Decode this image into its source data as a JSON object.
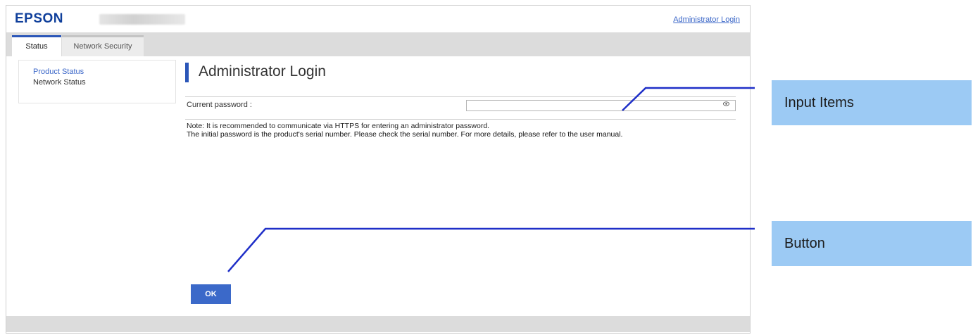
{
  "header": {
    "logo": "EPSON",
    "admin_login_link": "Administrator Login"
  },
  "tabs": [
    {
      "label": "Status",
      "active": true
    },
    {
      "label": "Network Security",
      "active": false
    }
  ],
  "sidebar": {
    "items": [
      {
        "label": "Product Status",
        "selected": true
      },
      {
        "label": "Network Status",
        "selected": false
      }
    ]
  },
  "main": {
    "title": "Administrator Login",
    "password_label": "Current password :",
    "password_value": "",
    "note_line1": "Note: It is recommended to communicate via HTTPS for entering an administrator password.",
    "note_line2": "The initial password is the product's serial number. Please check the serial number. For more details, please refer to the user manual.",
    "ok_label": "OK"
  },
  "callouts": {
    "input_items": "Input Items",
    "button": "Button"
  },
  "colors": {
    "brand": "#0f3f9b",
    "accent": "#2b56b8",
    "link": "#3a66c8",
    "button": "#3b69c9",
    "callout": "#9ccaf4",
    "callout_line": "#1f2fc8"
  },
  "icons": {
    "password_toggle": "eye-icon"
  }
}
